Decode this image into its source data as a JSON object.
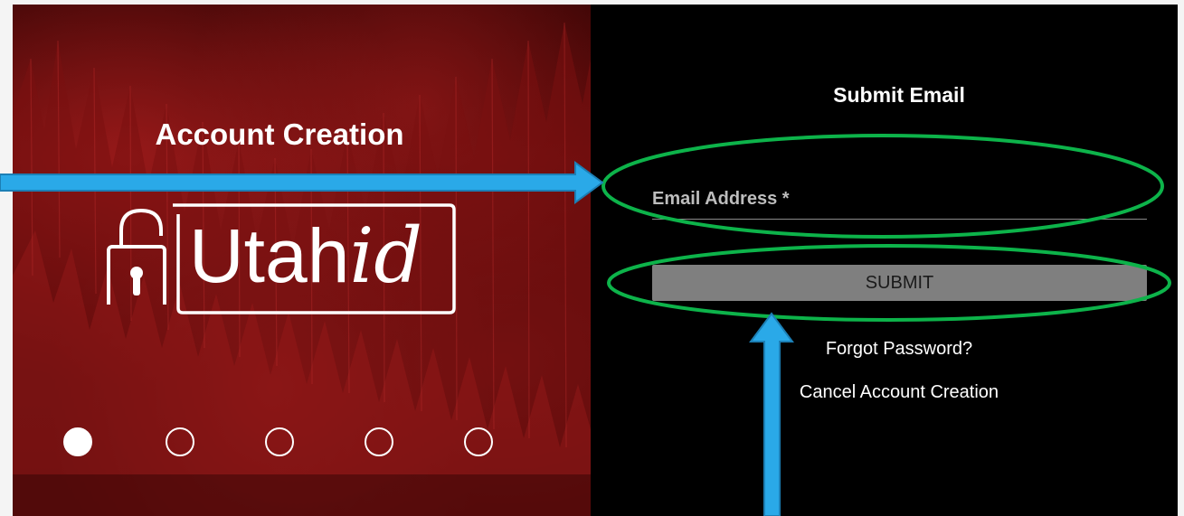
{
  "left_panel": {
    "title": "Account Creation",
    "logo": {
      "word_plain": "Utah",
      "word_italic": "id",
      "icon": "padlock-icon"
    },
    "carousel": {
      "dot_count": 5,
      "active_index": 0
    }
  },
  "right_panel": {
    "title": "Submit Email",
    "email_field": {
      "placeholder": "Email Address *",
      "value": ""
    },
    "submit_label": "SUBMIT",
    "forgot_password_label": "Forgot Password?",
    "cancel_label": "Cancel Account Creation"
  },
  "annotations": {
    "arrow_color": "#2aa9e8",
    "highlight_color": "#0db34a"
  },
  "colors": {
    "right_panel_bg": "#000000",
    "button_bg": "#7f7f7f",
    "text": "#ffffff"
  }
}
